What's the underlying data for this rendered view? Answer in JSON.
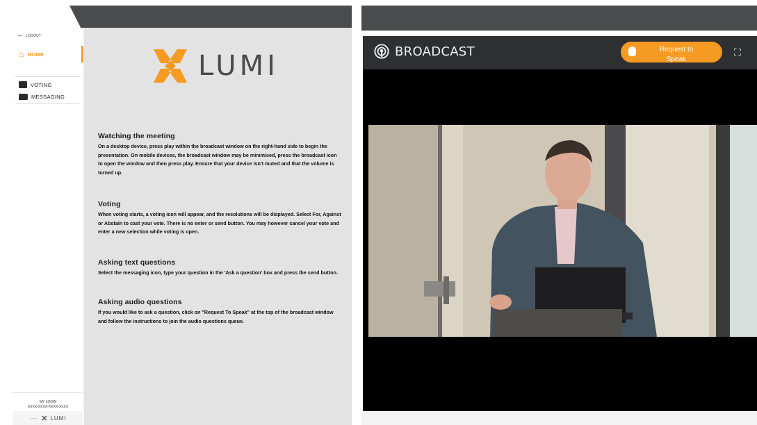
{
  "sidebar": {
    "back_label": "LOGOUT",
    "items": [
      {
        "label": "HOME",
        "icon": "home-icon"
      },
      {
        "label": "VOTING",
        "icon": "voting-icon"
      },
      {
        "label": "MESSAGING",
        "icon": "messaging-icon"
      }
    ],
    "footer_line1": "MY LOGIN",
    "footer_line2": "XXXX-XXXX-XXXX-XXXX",
    "brand": "LUMI"
  },
  "logo": {
    "text": "LUMI"
  },
  "sections": [
    {
      "heading": "Watching the meeting",
      "body": "On a desktop device, press play within the broadcast window on the right-hand side to begin the presentation. On mobile devices, the broadcast window may be minimised, press the broadcast icon to open the window and then press play. Ensure that your device isn't muted and that the volume is turned up."
    },
    {
      "heading": "Voting",
      "body": "When voting starts, a voting icon will appear, and the resolutions will be displayed. Select For, Against or Abstain to cast your vote. There is no enter or send button. You may however cancel your vote and enter a new selection while voting is open."
    },
    {
      "heading": "Asking text questions",
      "body": "Select the messaging icon, type your question in the 'Ask a question' box and press the send button."
    },
    {
      "heading": "Asking audio questions",
      "body": "If you would like to ask a question, click on \"Request To Speak\" at the top of the broadcast window and follow the instructions to join the audio questions queue."
    }
  ],
  "broadcast": {
    "title": "BROADCAST",
    "request_line1": "Request to",
    "request_line2": "Speak"
  },
  "colors": {
    "accent": "#f59a23",
    "header_dark": "#4a4b4d",
    "broadcast_bar": "#2e2f31",
    "content_bg": "#e3e3e3"
  }
}
